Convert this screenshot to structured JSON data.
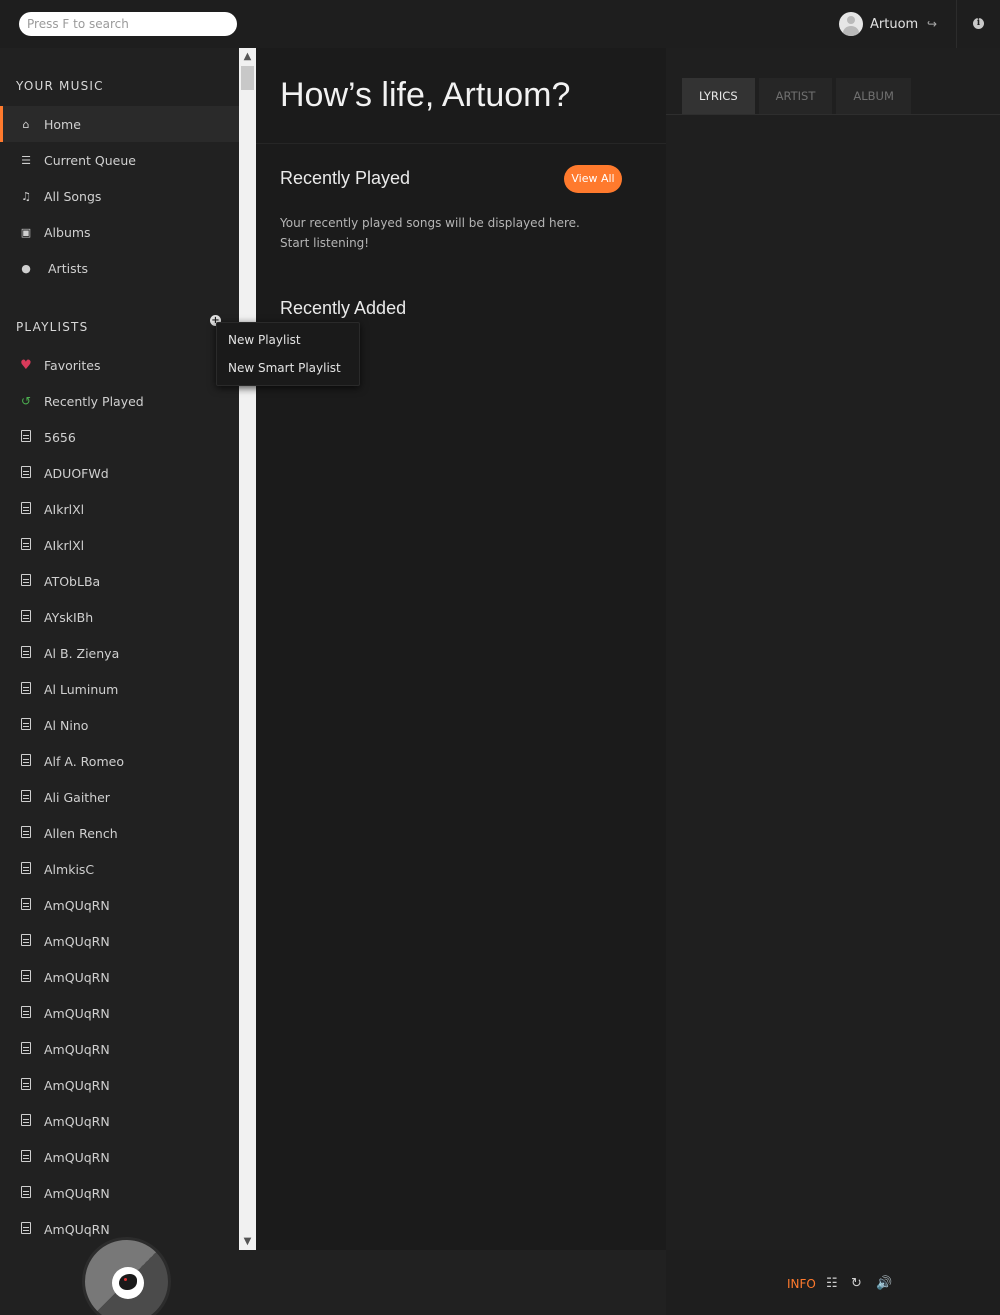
{
  "header": {
    "search_placeholder": "Press F to search",
    "username": "Artuom",
    "logout_icon": "sign-out-icon",
    "about_icon": "info-icon"
  },
  "sidebar": {
    "your_music_title": "YOUR MUSIC",
    "nav_items": [
      {
        "label": "Home",
        "icon": "home-icon",
        "active": true
      },
      {
        "label": "Current Queue",
        "icon": "list-icon"
      },
      {
        "label": "All Songs",
        "icon": "music-icon"
      },
      {
        "label": "Albums",
        "icon": "album-icon"
      },
      {
        "label": "Artists",
        "icon": "microphone-icon"
      }
    ],
    "playlists_title": "PLAYLISTS",
    "playlists": [
      {
        "label": "Favorites",
        "icon": "heart-icon"
      },
      {
        "label": "Recently Played",
        "icon": "history-icon"
      },
      {
        "label": "5656",
        "icon": "file-icon"
      },
      {
        "label": "ADUOFWd",
        "icon": "file-icon"
      },
      {
        "label": "AIkrlXl",
        "icon": "file-icon"
      },
      {
        "label": "AIkrlXl",
        "icon": "file-icon"
      },
      {
        "label": "ATObLBa",
        "icon": "file-icon"
      },
      {
        "label": "AYskIBh",
        "icon": "file-icon"
      },
      {
        "label": "Al B. Zienya",
        "icon": "file-icon"
      },
      {
        "label": "Al Luminum",
        "icon": "file-icon"
      },
      {
        "label": "Al Nino",
        "icon": "file-icon"
      },
      {
        "label": "Alf A. Romeo",
        "icon": "file-icon"
      },
      {
        "label": "Ali Gaither",
        "icon": "file-icon"
      },
      {
        "label": "Allen Rench",
        "icon": "file-icon"
      },
      {
        "label": "AlmkisC",
        "icon": "file-icon"
      },
      {
        "label": "AmQUqRN",
        "icon": "file-icon"
      },
      {
        "label": "AmQUqRN",
        "icon": "file-icon"
      },
      {
        "label": "AmQUqRN",
        "icon": "file-icon"
      },
      {
        "label": "AmQUqRN",
        "icon": "file-icon"
      },
      {
        "label": "AmQUqRN",
        "icon": "file-icon"
      },
      {
        "label": "AmQUqRN",
        "icon": "file-icon"
      },
      {
        "label": "AmQUqRN",
        "icon": "file-icon"
      },
      {
        "label": "AmQUqRN",
        "icon": "file-icon"
      },
      {
        "label": "AmQUqRN",
        "icon": "file-icon"
      },
      {
        "label": "AmQUqRN",
        "icon": "file-icon"
      }
    ]
  },
  "context_menu": {
    "items": [
      "New Playlist",
      "New Smart Playlist"
    ]
  },
  "main": {
    "greeting": "How’s life, Artuom?",
    "recently_played_title": "Recently Played",
    "view_all_label": "View All",
    "recently_played_empty_line1": "Your recently played songs will be displayed here.",
    "recently_played_empty_line2": "Start listening!",
    "recently_added_title": "Recently Added"
  },
  "extra_panel": {
    "tabs": [
      {
        "label": "LYRICS",
        "active": true
      },
      {
        "label": "ARTIST"
      },
      {
        "label": "ALBUM"
      }
    ]
  },
  "footer": {
    "info_label": "INFO",
    "controls": [
      "equalizer-icon",
      "repeat-icon",
      "volume-icon"
    ]
  },
  "colors": {
    "accent": "#ff7a2d",
    "favorites": "#d93a5a",
    "recently_played": "#4caf50"
  }
}
